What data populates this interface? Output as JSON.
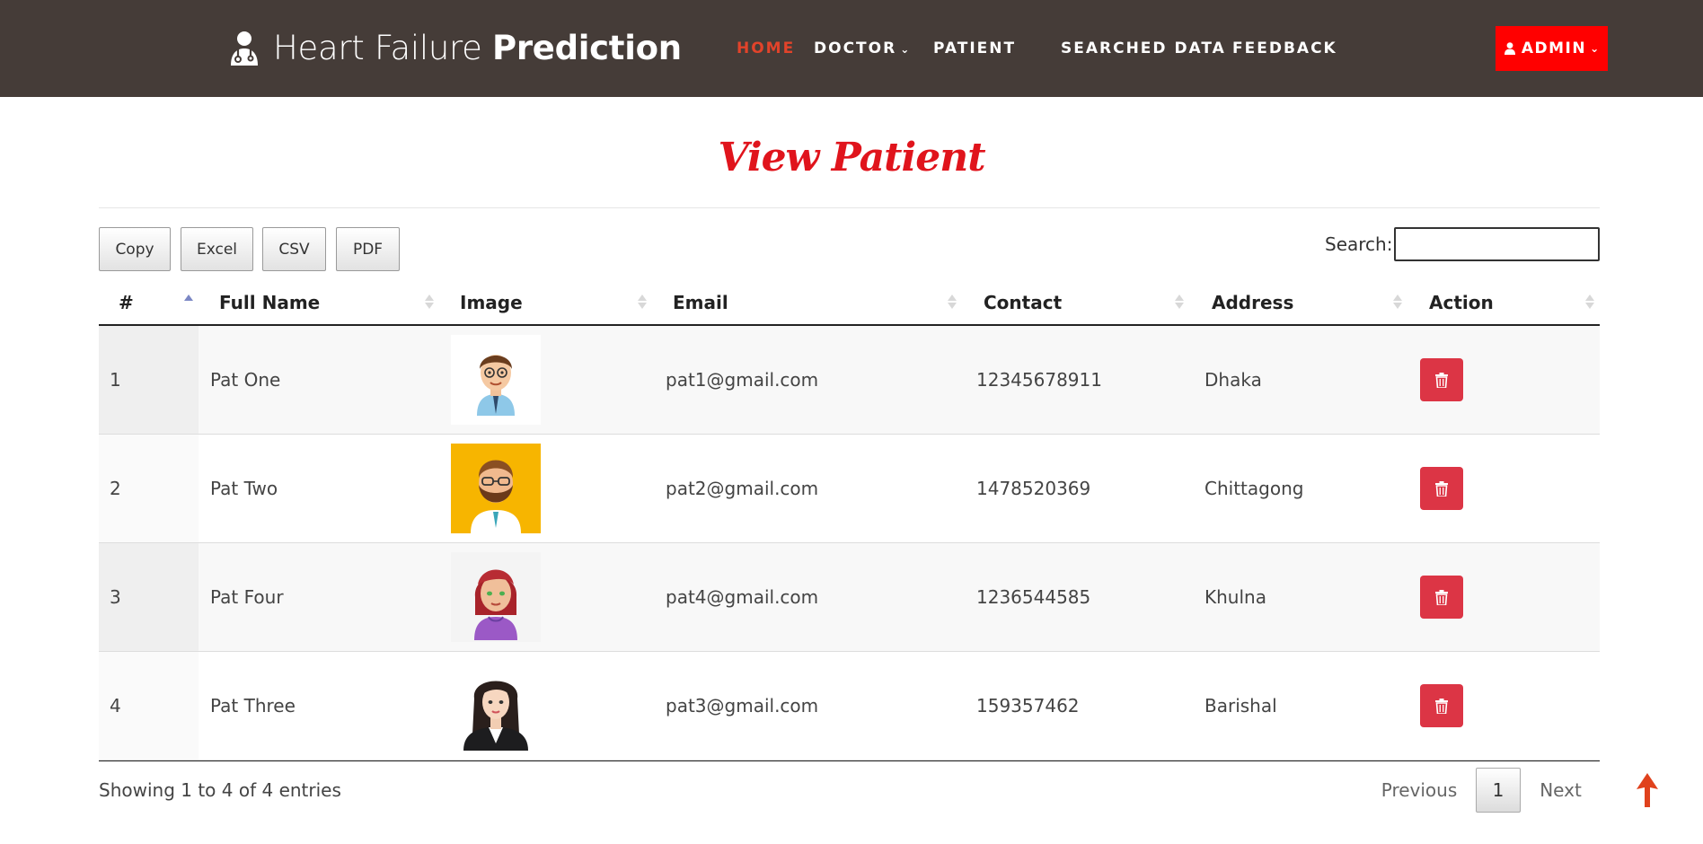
{
  "brand": {
    "light": "Heart Failure",
    "bold": "Prediction"
  },
  "nav": {
    "home": "HOME",
    "doctor": "DOCTOR",
    "patient": "PATIENT",
    "searched_data": "SEARCHED DATA",
    "feedback": "FEEDBACK",
    "admin": "ADMIN"
  },
  "page": {
    "title": "View Patient"
  },
  "export": {
    "copy": "Copy",
    "excel": "Excel",
    "csv": "CSV",
    "pdf": "PDF"
  },
  "search": {
    "label": "Search:",
    "value": ""
  },
  "table": {
    "columns": [
      "#",
      "Full Name",
      "Image",
      "Email",
      "Contact",
      "Address",
      "Action"
    ],
    "sorted_column": "#",
    "sort_direction": "asc",
    "rows": [
      {
        "num": "1",
        "name": "Pat One",
        "avatar": "male-avatar-blue-shirt",
        "email": "pat1@gmail.com",
        "contact": "12345678911",
        "address": "Dhaka",
        "action_icon": "trash-icon"
      },
      {
        "num": "2",
        "name": "Pat Two",
        "avatar": "bearded-man-avatar-yellow-bg",
        "email": "pat2@gmail.com",
        "contact": "1478520369",
        "address": "Chittagong",
        "action_icon": "trash-icon"
      },
      {
        "num": "3",
        "name": "Pat Four",
        "avatar": "red-hair-woman-avatar",
        "email": "pat4@gmail.com",
        "contact": "1236544585",
        "address": "Khulna",
        "action_icon": "trash-icon"
      },
      {
        "num": "4",
        "name": "Pat Three",
        "avatar": "businesswoman-avatar",
        "email": "pat3@gmail.com",
        "contact": "159357462",
        "address": "Barishal",
        "action_icon": "trash-icon"
      }
    ]
  },
  "footer": {
    "info": "Showing 1 to 4 of 4 entries",
    "previous": "Previous",
    "current_page": "1",
    "next": "Next"
  },
  "colors": {
    "navbar": "#453c38",
    "nav_active": "#e2432a",
    "admin_button": "#ff0000",
    "title": "#e0141c",
    "delete_button": "#dc3545",
    "scroll_top_arrow": "#e0421d"
  }
}
